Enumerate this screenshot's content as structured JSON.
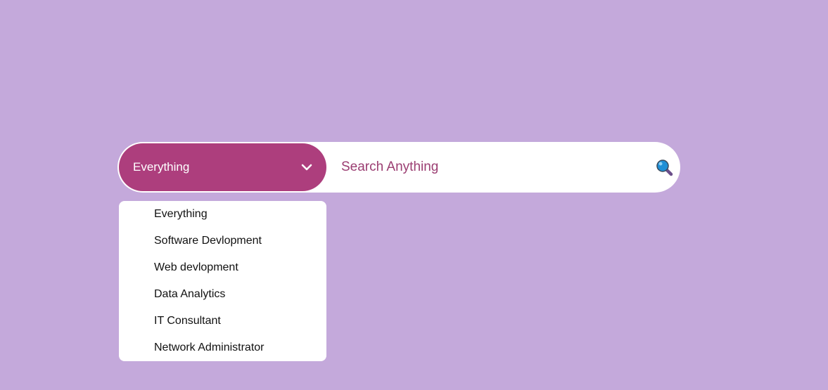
{
  "search": {
    "category_selected": "Everything",
    "placeholder": "Search Anything",
    "value": ""
  },
  "dropdown": {
    "options": [
      {
        "label": "Everything"
      },
      {
        "label": "Software Devlopment"
      },
      {
        "label": "Web devlopment"
      },
      {
        "label": "Data Analytics"
      },
      {
        "label": "IT Consultant"
      },
      {
        "label": "Network Administrator"
      }
    ]
  },
  "icons": {
    "chevron": "chevron-down-icon",
    "search": "magnifier-icon"
  },
  "colors": {
    "background": "#c4a9db",
    "accent": "#ad3e7d",
    "placeholder_text": "#9b3e72"
  }
}
